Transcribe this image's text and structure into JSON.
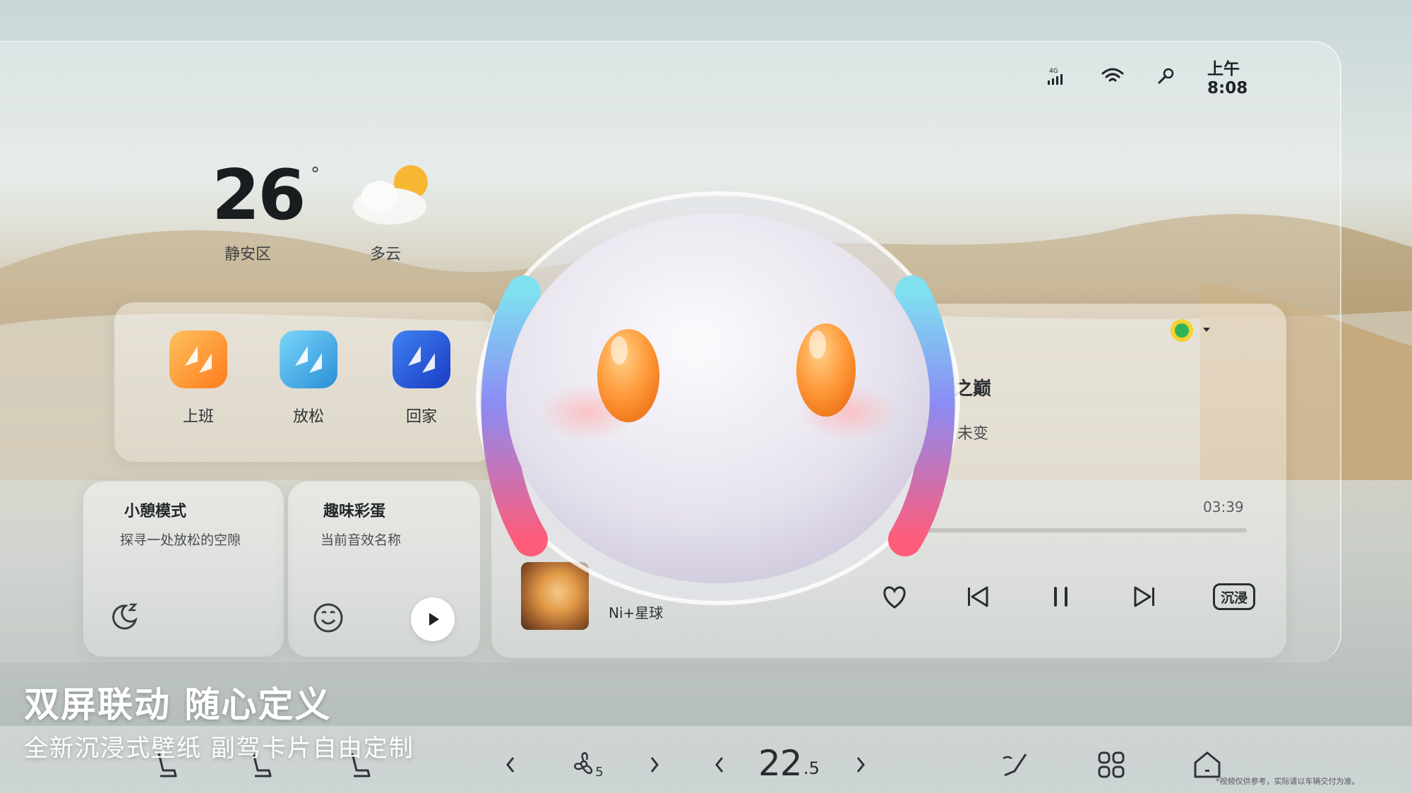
{
  "status_bar": {
    "network": "4G",
    "time": "上午 8:08"
  },
  "weather": {
    "temperature": "26",
    "degree_symbol": "°",
    "location": "静安区",
    "condition": "多云"
  },
  "scenes": [
    {
      "label": "上班",
      "color_a": "#ffb347",
      "color_b": "#ff7a1a"
    },
    {
      "label": "放松",
      "color_a": "#6ecff6",
      "color_b": "#2a8fd8"
    },
    {
      "label": "回家",
      "color_a": "#3a7cf0",
      "color_b": "#1b3fc7"
    }
  ],
  "rest_card": {
    "title": "小憩模式",
    "subtitle": "探寻一处放松的空隙"
  },
  "egg_card": {
    "title": "趣味彩蛋",
    "subtitle": "当前音效名称"
  },
  "music": {
    "title_partial": "之巅",
    "artist_partial": "未变",
    "duration": "03:39",
    "progress": 0.0,
    "source": "Ni+星球",
    "immersive_label": "沉浸"
  },
  "climate": {
    "fan_level": "5",
    "temp_int": "22",
    "temp_dec": ".5"
  },
  "caption": {
    "title": "双屏联动 随心定义",
    "subtitle": "全新沉浸式壁纸 副驾卡片自由定制"
  },
  "disclaimer": "*视频仅供参考，实际请以车辆交付为准。"
}
